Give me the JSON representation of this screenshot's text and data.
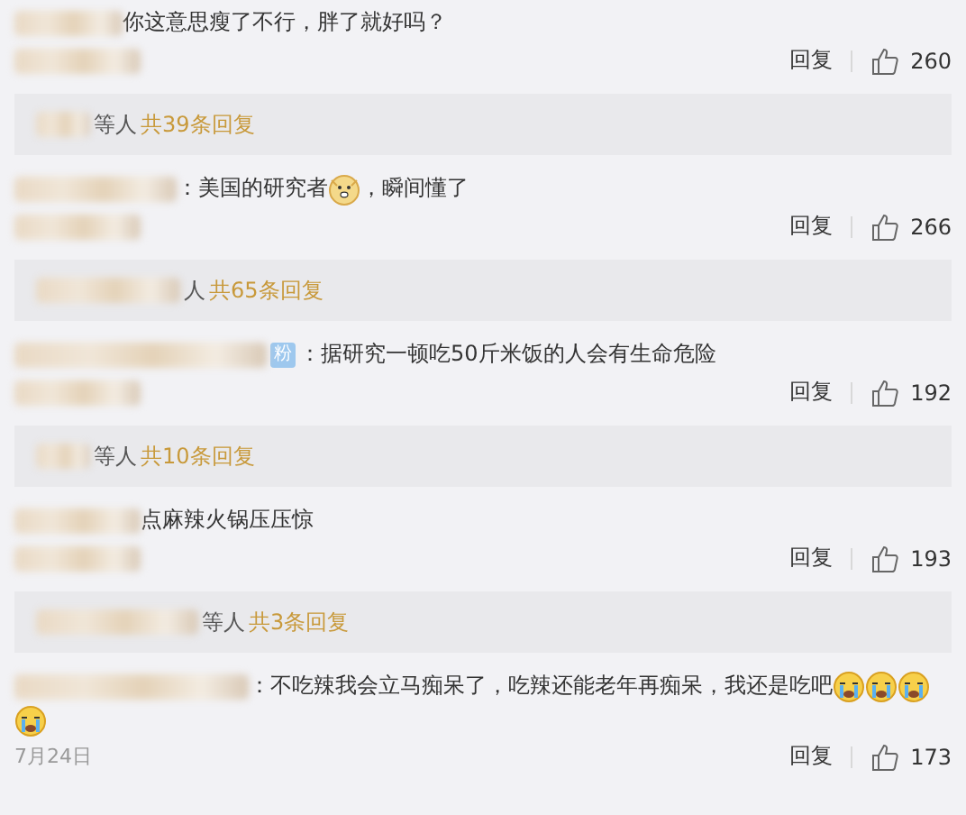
{
  "comments": [
    {
      "segments": [
        {
          "kind": "text",
          "text": "你这意思瘦了不行，胖了就好吗？"
        }
      ],
      "reply": "回复",
      "likes": "260",
      "thread": {
        "people": "等人",
        "count": "共39条回复"
      }
    },
    {
      "segments": [
        {
          "kind": "text",
          "text": "：美国的研究者"
        },
        {
          "kind": "doge"
        },
        {
          "kind": "text",
          "text": "，瞬间懂了"
        }
      ],
      "reply": "回复",
      "likes": "266",
      "thread": {
        "people": "人",
        "count": "共65条回复"
      }
    },
    {
      "segments": [
        {
          "kind": "text",
          "text": "：据研究一顿吃50斤米饭的人会有生命危险"
        }
      ],
      "badge": "粉",
      "reply": "回复",
      "likes": "192",
      "thread": {
        "people": "等人",
        "count": "共10条回复"
      }
    },
    {
      "segments": [
        {
          "kind": "text",
          "text": "点麻辣火锅压压惊"
        }
      ],
      "reply": "回复",
      "likes": "193",
      "thread": {
        "people": "等人",
        "count": "共3条回复"
      }
    },
    {
      "segments": [
        {
          "kind": "text",
          "text": "：不吃辣我会立马痴呆了，吃辣还能老年再痴呆，我还是吃吧"
        },
        {
          "kind": "cry"
        },
        {
          "kind": "cry"
        },
        {
          "kind": "cry"
        },
        {
          "kind": "cry"
        }
      ],
      "date": "7月24日",
      "reply": "回复",
      "likes": "173"
    }
  ]
}
